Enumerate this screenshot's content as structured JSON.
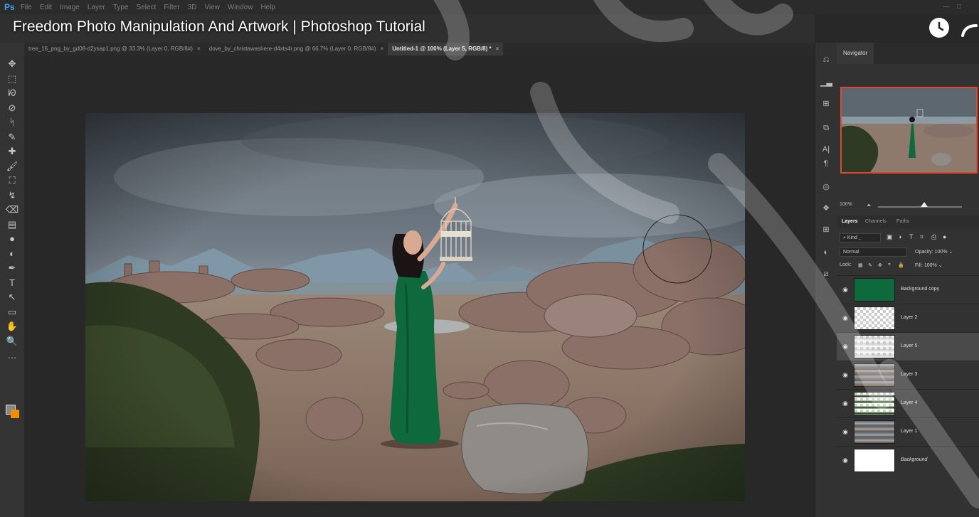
{
  "app": {
    "logo": "Ps",
    "menu": [
      "File",
      "Edit",
      "Image",
      "Layer",
      "Type",
      "Select",
      "Filter",
      "3D",
      "View",
      "Window",
      "Help"
    ],
    "win_min": "—",
    "win_max": "□"
  },
  "video_title": "Freedom Photo Manipulation And Artwork | Photoshop Tutorial",
  "tabs": [
    {
      "label": "tree_16_png_by_gd08-d2ysap1.png @ 33.3% (Layer 0, RGB/8#)",
      "close": "×"
    },
    {
      "label": "dove_by_christawashere-d4xts4r.png @ 66.7% (Layer 0, RGB/8#)",
      "close": "×"
    },
    {
      "label": "Untitled-1 @ 100% (Layer 5, RGB/8) *",
      "close": "×"
    }
  ],
  "colors": {
    "accent": "#e2462f",
    "background_swatch": "#f28c00",
    "foreground_swatch": "#888888",
    "dress": "#0e6a3c",
    "selected_layer": "#4a4a4a"
  },
  "tools": [
    "move-icon",
    "marquee-icon",
    "lasso-icon",
    "quick-select-icon",
    "crop-icon",
    "eyedropper-icon",
    "healing-icon",
    "brush-icon",
    "stamp-icon",
    "history-brush-icon",
    "eraser-icon",
    "gradient-icon",
    "blur-icon",
    "dodge-icon",
    "pen-icon",
    "type-icon",
    "path-select-icon",
    "shape-icon",
    "hand-icon",
    "zoom-icon",
    "more-tools-icon"
  ],
  "tool_glyphs": [
    "✥",
    "⬚",
    "ᘗ",
    "⊘",
    "ᛋ",
    "✎",
    "✚",
    "🖌",
    "⛶",
    "↯",
    "⌫",
    "▤",
    "●",
    "◐",
    "✒",
    "T",
    "↖",
    "▭",
    "✋",
    "🔍",
    "…"
  ],
  "navigator": {
    "tab": "Navigator",
    "zoom": "100%"
  },
  "layers_panel": {
    "tabs": [
      "Layers",
      "Channels",
      "Paths"
    ],
    "filter_kind": "Kind",
    "blend_mode": "Normal",
    "opacity_label": "Opacity:",
    "opacity": "100%",
    "lock_label": "Lock:",
    "fill_label": "Fill:",
    "fill": "100%",
    "layers": [
      {
        "name": "Background copy",
        "thumb": "figure",
        "selected": false,
        "italic": false
      },
      {
        "name": "Layer 2",
        "thumb": "transparent",
        "selected": false,
        "italic": false
      },
      {
        "name": "Layer 5",
        "thumb": "haze",
        "selected": true,
        "italic": false
      },
      {
        "name": "Layer 3",
        "thumb": "landscape",
        "selected": false,
        "italic": false
      },
      {
        "name": "Layer 4",
        "thumb": "trees",
        "selected": false,
        "italic": false
      },
      {
        "name": "Layer 1",
        "thumb": "sky",
        "selected": false,
        "italic": false
      },
      {
        "name": "Background",
        "thumb": "white",
        "selected": false,
        "italic": true
      }
    ]
  }
}
